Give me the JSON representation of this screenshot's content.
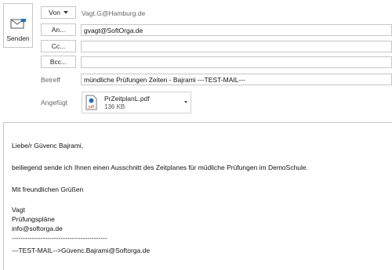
{
  "send": {
    "label": "Senden",
    "icon": "send-mail-icon"
  },
  "header": {
    "from": {
      "button_label": "Von",
      "address": "Vagt.G@Hamburg.de"
    },
    "to": {
      "button_label": "An...",
      "value": "gvagt@SoftOrga.de"
    },
    "cc": {
      "button_label": "Cc...",
      "value": ""
    },
    "bcc": {
      "button_label": "Bcc...",
      "value": ""
    },
    "subject": {
      "label": "Betreff",
      "value": "mündliche Prüfungen Zeiten - Bajrami ---TEST-MAIL---"
    },
    "attached": {
      "label": "Angefügt",
      "file_name": "PrZeitplanL.pdf",
      "file_size": "136 KB",
      "icon": "pdf-file-icon"
    }
  },
  "body": {
    "lines": [
      "Liebe/r  Güvenc Bajrami,",
      "beiliegend sende ich Ihnen einen Ausschnitt des Zeitplanes für müdliche Prüfungen im DemoSchule.",
      "Mit freundlichen Grüßen",
      "Vagt",
      "Prüfungspläne",
      "info@softorga.de",
      "-------------------------------------------",
      " ---TEST-MAIL-->Güvenc.Bajrami@Softorga.de"
    ]
  },
  "colors": {
    "border": "#c6c6c6",
    "accent_blue": "#1e6fc0",
    "pdf_red": "#c8312c"
  }
}
